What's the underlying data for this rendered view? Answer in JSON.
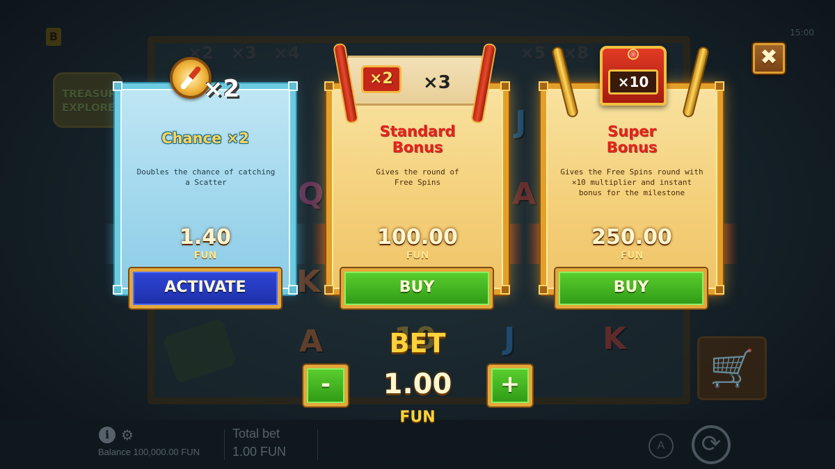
{
  "background": {
    "brand_letter": "B",
    "game_logo": "TREASURE EXPLORER",
    "clock": "15:00",
    "path_multipliers": [
      "×2",
      "×3",
      "×4",
      "×5",
      "×8"
    ],
    "reel_letters": [
      "A",
      "10",
      "J",
      "K",
      "Q",
      "J",
      "A",
      "K"
    ]
  },
  "cards": [
    {
      "id": "chance",
      "badge_multiplier": "×2",
      "title": "Chance ×2",
      "description": "Doubles the chance of catching a Scatter",
      "price": "1.40",
      "currency": "FUN",
      "action_label": "ACTIVATE",
      "theme_color": "#6ccbe0"
    },
    {
      "id": "standard",
      "badge_multiplier": "×2",
      "badge_multiplier_2": "×3",
      "title": "Standard Bonus",
      "description": "Gives the round of Free Spins",
      "price": "100.00",
      "currency": "FUN",
      "action_label": "BUY",
      "theme_color": "#e2a02a"
    },
    {
      "id": "super",
      "badge_multiplier": "×10",
      "title": "Super Bonus",
      "description": "Gives the Free Spins round with ×10 multiplier and instant bonus for the milestone",
      "price": "250.00",
      "currency": "FUN",
      "action_label": "BUY",
      "theme_color": "#e2a02a"
    }
  ],
  "bet": {
    "label": "BET",
    "value": "1.00",
    "currency": "FUN",
    "minus_label": "-",
    "plus_label": "+"
  },
  "close_label": "✖",
  "footer": {
    "info_label": "i",
    "balance": "Balance 100,000.00 FUN",
    "total_bet_label": "Total bet",
    "total_bet_value": "1.00 FUN",
    "auto_label": "A"
  },
  "colors": {
    "accent_gold": "#ffd23a",
    "buy_green": "#3fb51e",
    "activate_blue": "#2439c4",
    "title_red": "#e2231a"
  }
}
